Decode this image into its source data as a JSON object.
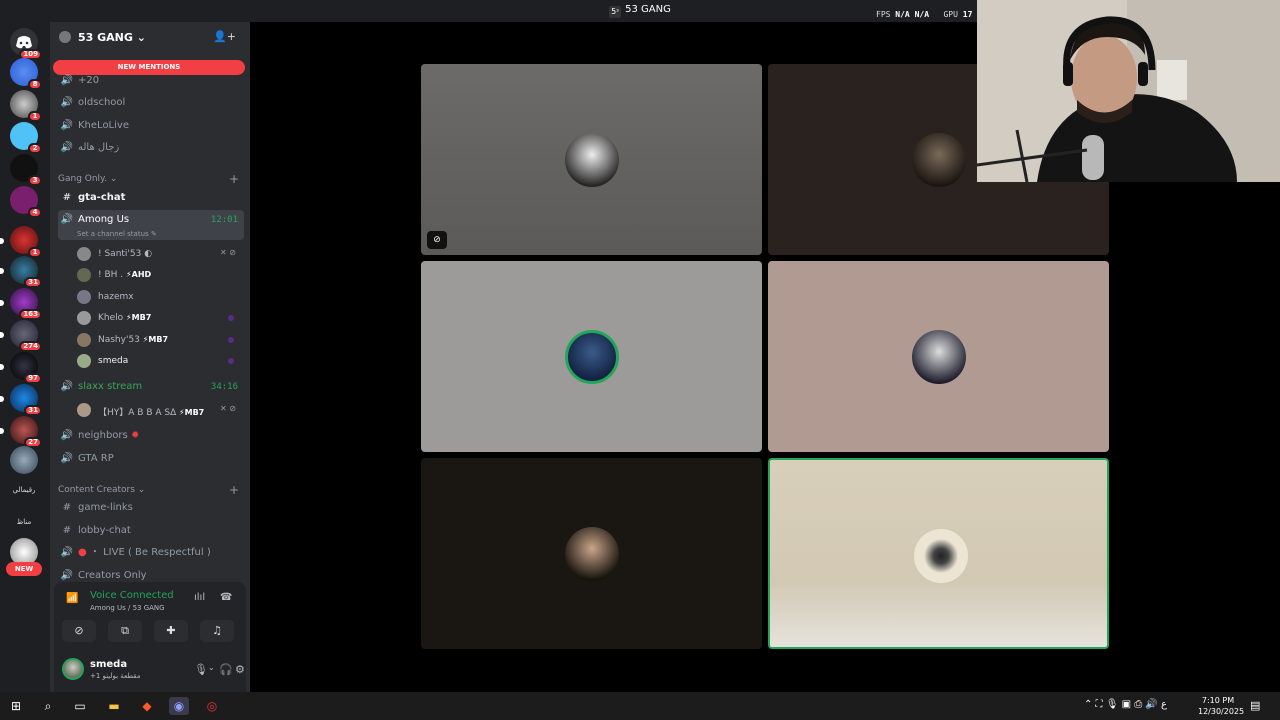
{
  "window": {
    "title": "53 GANG",
    "server_icon_text": "5ˢ"
  },
  "perf": {
    "fps_label": "FPS",
    "fps_value1": "N/A",
    "fps_value2": "N/A",
    "gpu_label": "GPU",
    "gpu_value": "17 %"
  },
  "guilds": {
    "badges": [
      "109",
      "8",
      "1",
      "2",
      "3",
      "4",
      "1",
      "31",
      "163",
      "274",
      "97",
      "31",
      "27"
    ],
    "text_items": [
      "رقيمالي",
      "مناظ"
    ],
    "new_label": "NEW"
  },
  "server": {
    "name": "53 GANG",
    "new_mentions": "NEW MENTIONS"
  },
  "channels": {
    "top": [
      "+20",
      "oldschool",
      "KheLoLive",
      "زجال هاله"
    ],
    "cat_gang": "Gang Only.",
    "gta_chat": "gta-chat",
    "among_us": "Among Us",
    "among_us_time": "12:01",
    "channel_status_hint": "Set a channel status",
    "among_users": [
      {
        "name": "! Santi'53",
        "tag": ""
      },
      {
        "name": "! BH .",
        "tag": "⚡AHD"
      },
      {
        "name": "hazemx",
        "tag": ""
      },
      {
        "name": "Khelo",
        "tag": "⚡MB7"
      },
      {
        "name": "Nashy'53",
        "tag": "⚡MB7"
      },
      {
        "name": "smeda",
        "tag": ""
      }
    ],
    "slaxx": "slaxx stream",
    "slaxx_time": "34:16",
    "slaxx_user": "【HY】A B B A S∆",
    "slaxx_user_tag": "⚡MB7",
    "neighbors": "neighbors",
    "gta_rp": "GTA RP",
    "cat_content": "Content Creators",
    "game_links": "game-links",
    "lobby_chat": "lobby-chat",
    "live": "・ LIVE ( Be Respectful )",
    "creators_only": "Creators Only"
  },
  "voice": {
    "connected": "Voice Connected",
    "location": "Among Us / 53 GANG"
  },
  "user": {
    "name": "smeda",
    "status": "+1 مقطعة بولينو"
  },
  "clock": {
    "time": "7:10 PM",
    "date": "12/30/2025"
  },
  "tray_lang": "ع",
  "colors": {
    "green": "#23a55a",
    "red": "#f23f43",
    "sidebar": "#2b2d31",
    "rail": "#1e1f22"
  }
}
